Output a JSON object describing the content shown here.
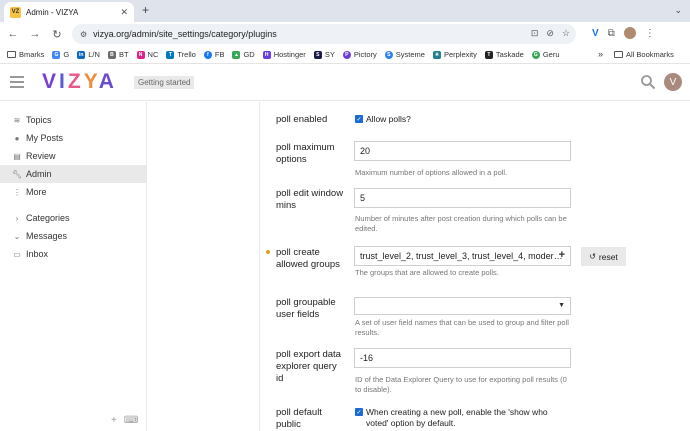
{
  "browser": {
    "tab_title": "Admin - VIZYA",
    "favicon_text": "VZ",
    "url": "vizya.org/admin/site_settings/category/plugins"
  },
  "bookmarks": [
    {
      "label": "Bmarks",
      "color": "#555555"
    },
    {
      "label": "G",
      "color": "#4285f4"
    },
    {
      "label": "L/N",
      "color": "#0a66c2"
    },
    {
      "label": "BT",
      "color": "#6b6b6b"
    },
    {
      "label": "NC",
      "color": "#e0218a"
    },
    {
      "label": "Trello",
      "color": "#0079bf"
    },
    {
      "label": "FB",
      "color": "#1877f2"
    },
    {
      "label": "GD",
      "color": "#34a853"
    },
    {
      "label": "Hostinger",
      "color": "#673de6"
    },
    {
      "label": "SY",
      "color": "#1b1b4b"
    },
    {
      "label": "Pictory",
      "color": "#6f3bd8"
    },
    {
      "label": "Systeme",
      "color": "#2f80ed"
    },
    {
      "label": "Perplexity",
      "color": "#20808d"
    },
    {
      "label": "Taskade",
      "color": "#222222"
    },
    {
      "label": "Geru",
      "color": "#3aa655"
    }
  ],
  "bookmarks_all": "All Bookmarks",
  "header": {
    "logo": [
      "V",
      "I",
      "Z",
      "Y",
      "A"
    ],
    "getting_started": "Getting started",
    "avatar_letter": "V"
  },
  "sidebar": {
    "items": [
      {
        "label": "Topics"
      },
      {
        "label": "My Posts"
      },
      {
        "label": "Review"
      },
      {
        "label": "Admin"
      },
      {
        "label": "More"
      }
    ],
    "sections": [
      {
        "label": "Categories"
      },
      {
        "label": "Messages"
      }
    ],
    "inbox": "Inbox"
  },
  "settings": {
    "poll_enabled": {
      "label": "poll enabled",
      "checkbox_label": "Allow polls?"
    },
    "poll_maximum_options": {
      "label": "poll maximum options",
      "value": "20",
      "help": "Maximum number of options allowed in a poll."
    },
    "poll_edit_window_mins": {
      "label": "poll edit window mins",
      "value": "5",
      "help": "Number of minutes after post creation during which polls can be edited."
    },
    "poll_create_allowed_groups": {
      "label": "poll create allowed groups",
      "value": "trust_level_2, trust_level_3, trust_level_4, moder…",
      "help": "The groups that are allowed to create polls.",
      "reset_label": "reset"
    },
    "poll_groupable_user_fields": {
      "label": "poll groupable user fields",
      "value": "",
      "help": "A set of user field names that can be used to group and filter poll results."
    },
    "poll_export_data_explorer_query_id": {
      "label": "poll export data explorer query id",
      "value": "-16",
      "help": "ID of the Data Explorer Query to use for exporting poll results (0 to disable)."
    },
    "poll_default_public": {
      "label": "poll default public",
      "checkbox_label": "When creating a new poll, enable the 'show who voted' option by default."
    }
  }
}
